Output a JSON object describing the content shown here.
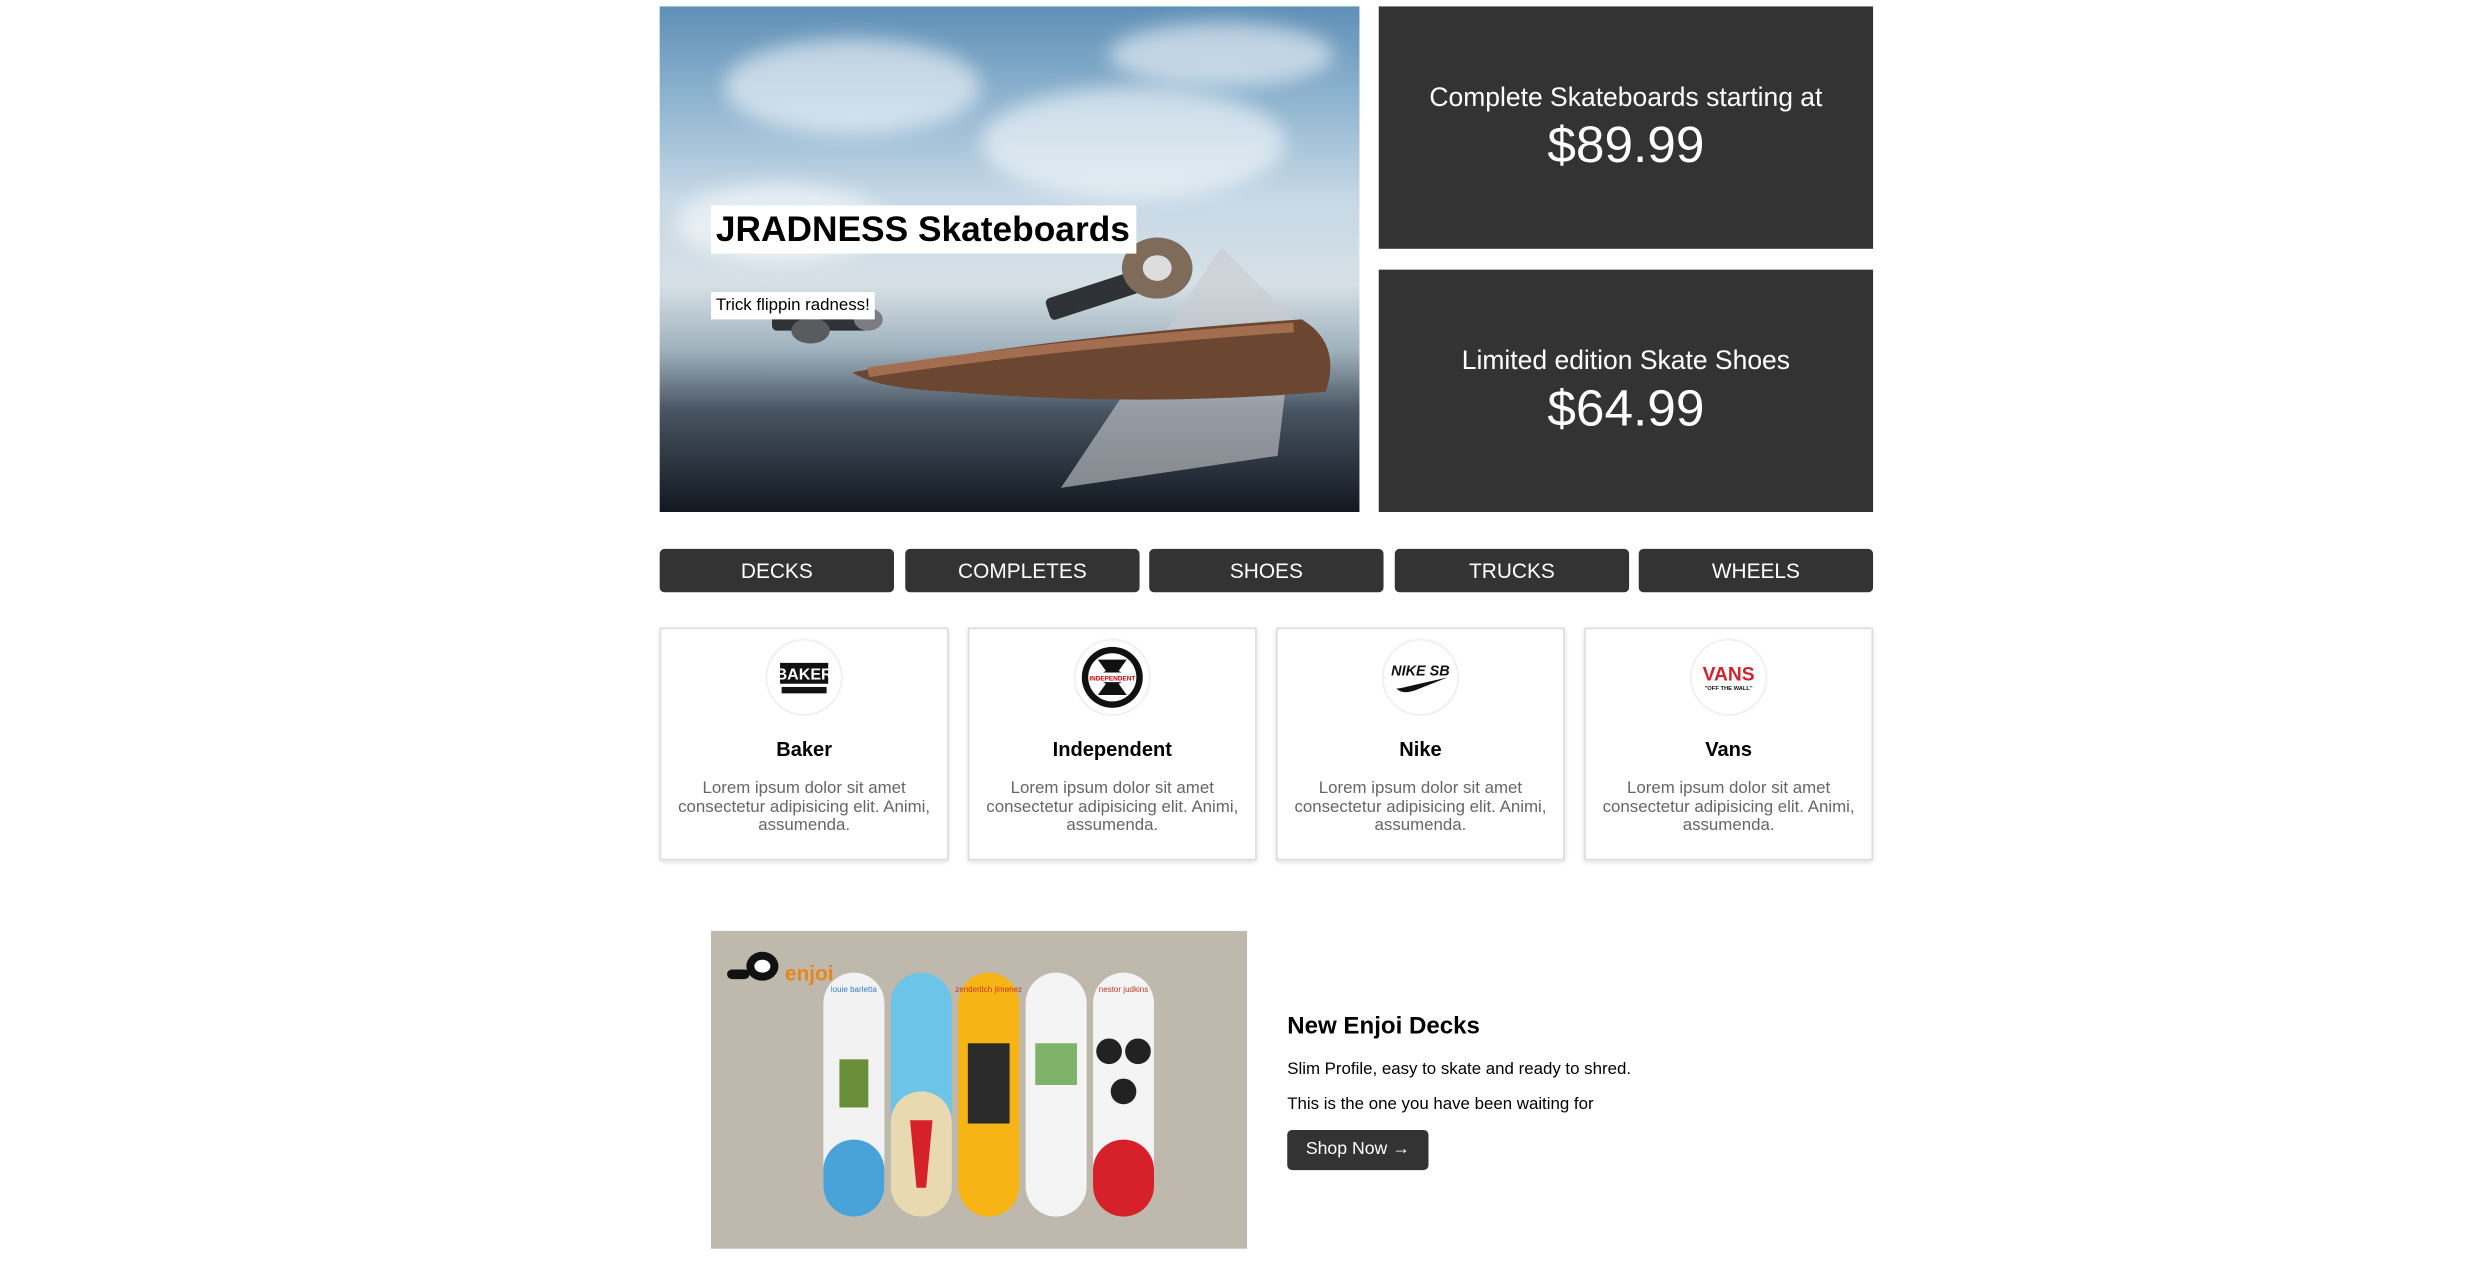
{
  "hero": {
    "title": "JRADNESS Skateboards",
    "tagline": "Trick flippin radness!"
  },
  "promos": [
    {
      "label": "Complete Skateboards starting at",
      "price": "$89.99"
    },
    {
      "label": "Limited edition Skate Shoes",
      "price": "$64.99"
    }
  ],
  "nav": [
    "DECKS",
    "COMPLETES",
    "SHOES",
    "TRUCKS",
    "WHEELS"
  ],
  "brands": [
    {
      "name": "Baker",
      "logo_text": "BAKER",
      "description": "Lorem ipsum dolor sit amet consectetur adipisicing elit. Animi, assumenda."
    },
    {
      "name": "Independent",
      "logo_text": "INDEPENDENT",
      "description": "Lorem ipsum dolor sit amet consectetur adipisicing elit. Animi, assumenda."
    },
    {
      "name": "Nike",
      "logo_text": "NIKE SB",
      "description": "Lorem ipsum dolor sit amet consectetur adipisicing elit. Animi, assumenda."
    },
    {
      "name": "Vans",
      "logo_text": "VANS",
      "logo_tagline": "\"OFF THE WALL\"",
      "description": "Lorem ipsum dolor sit amet consectetur adipisicing elit. Animi, assumenda."
    }
  ],
  "feature": {
    "brand_logo_text": "enjoi",
    "deck_names": [
      "louie barletta",
      "",
      "zenderitch jimenez",
      "",
      "nestor judkins"
    ],
    "title": "New Enjoi Decks",
    "line1": "Slim Profile, easy to skate and ready to shred.",
    "line2": "This is the one you have been waiting for",
    "button": "Shop Now →"
  },
  "colors": {
    "dark": "#333333",
    "white": "#ffffff",
    "muted_text": "#666666",
    "vans_red": "#d3222a"
  }
}
